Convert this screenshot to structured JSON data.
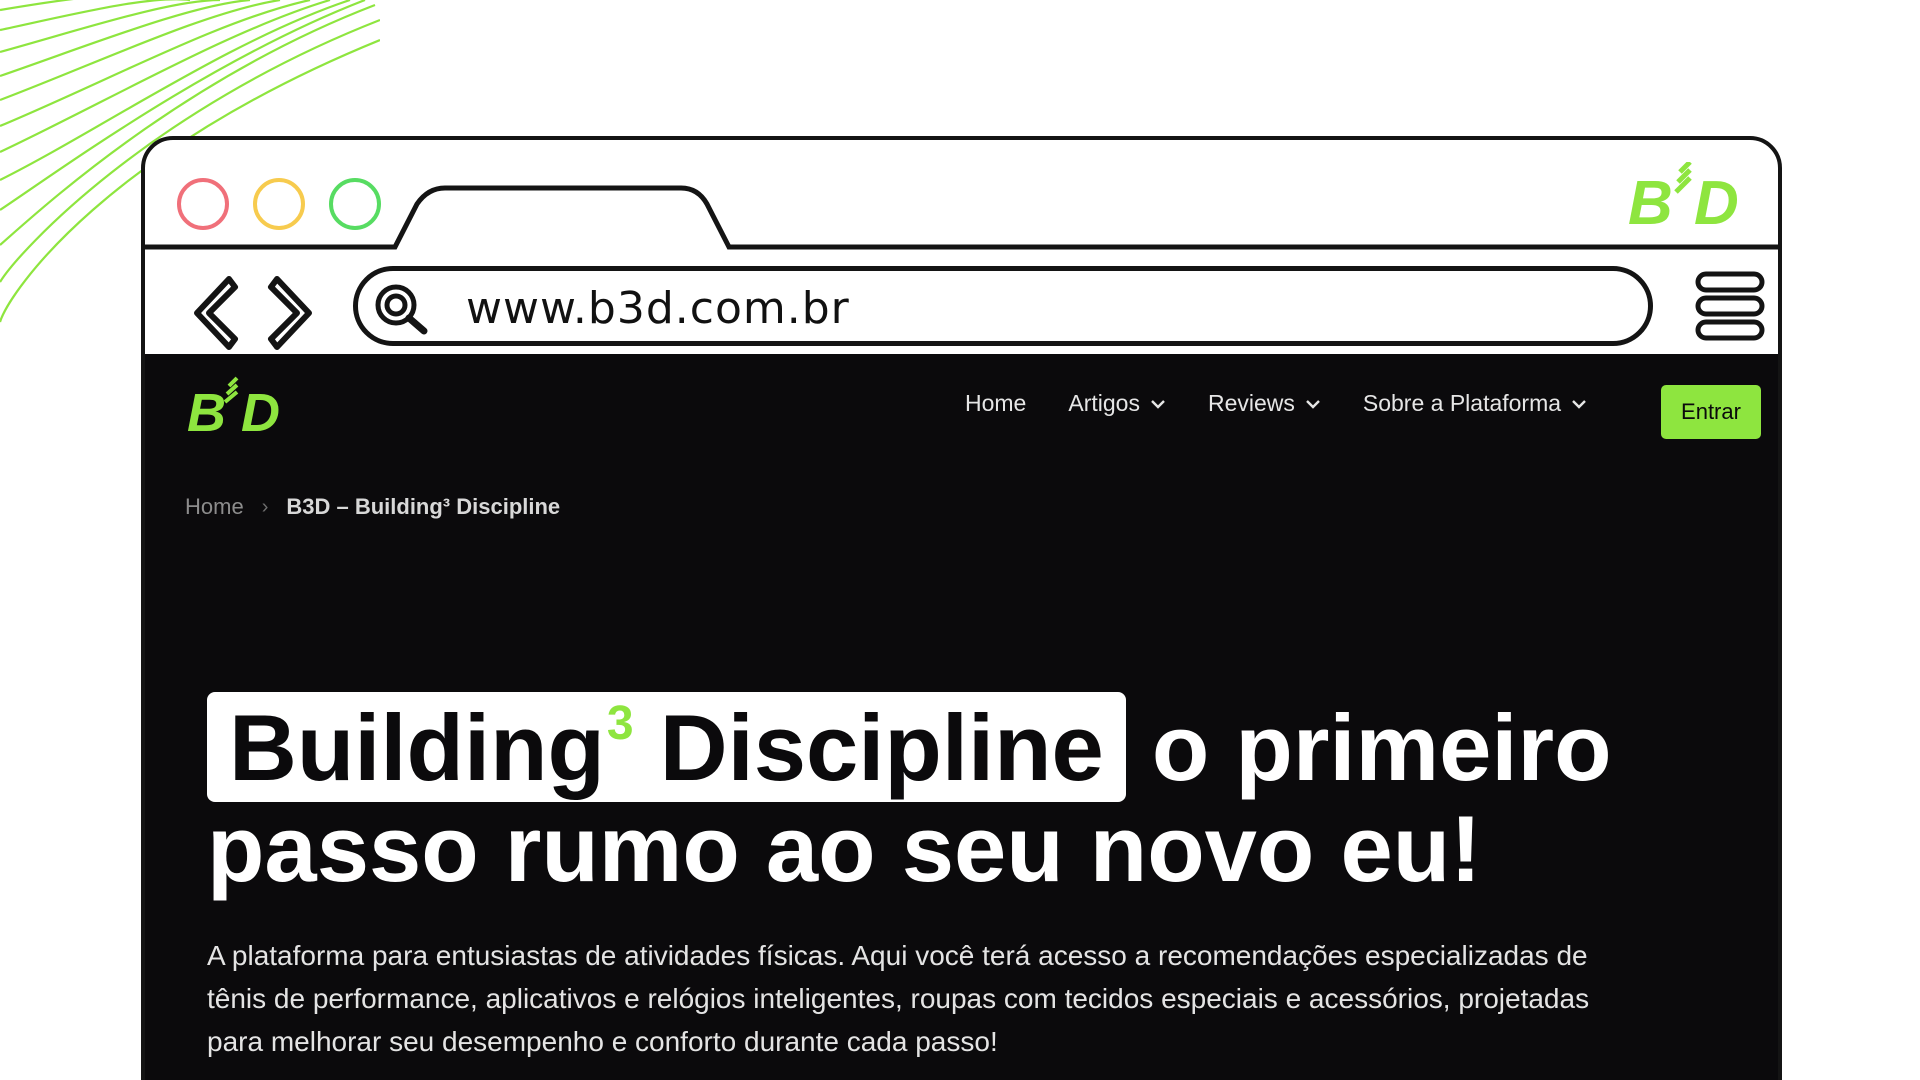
{
  "browser": {
    "url": "www.b3d.com.br",
    "brand_logo": "B³D"
  },
  "site": {
    "logo": "B³D",
    "nav": {
      "items": [
        {
          "label": "Home",
          "has_dropdown": false
        },
        {
          "label": "Artigos",
          "has_dropdown": true
        },
        {
          "label": "Reviews",
          "has_dropdown": true
        },
        {
          "label": "Sobre a Plataforma",
          "has_dropdown": true
        }
      ],
      "cta_label": "Entrar"
    },
    "breadcrumb": {
      "home": "Home",
      "separator": "›",
      "current": "B3D – Building³ Discipline"
    },
    "hero": {
      "highlight": "Building",
      "highlight_sup": "3",
      "highlight_end": " Discipline",
      "title_rest": " o primeiro",
      "title_line2": "passo rumo ao seu novo eu!",
      "description": "A plataforma para entusiastas de atividades físicas. Aqui você terá acesso a recomendações especializadas de tênis de performance, aplicativos e relógios inteligentes, roupas com tecidos especiais e acessórios, projetadas para melhorar seu desempenho e conforto durante cada passo!"
    }
  },
  "colors": {
    "accent": "#8ee53f",
    "site_bg": "#0b0a0c",
    "frame": "#141414",
    "dot_red": "#f0707a",
    "dot_yellow": "#f7cb4e",
    "dot_green": "#57dc62"
  },
  "icons": [
    "back-arrow-icon",
    "forward-arrow-icon",
    "search-icon",
    "hamburger-menu-icon",
    "chevron-down-icon"
  ]
}
